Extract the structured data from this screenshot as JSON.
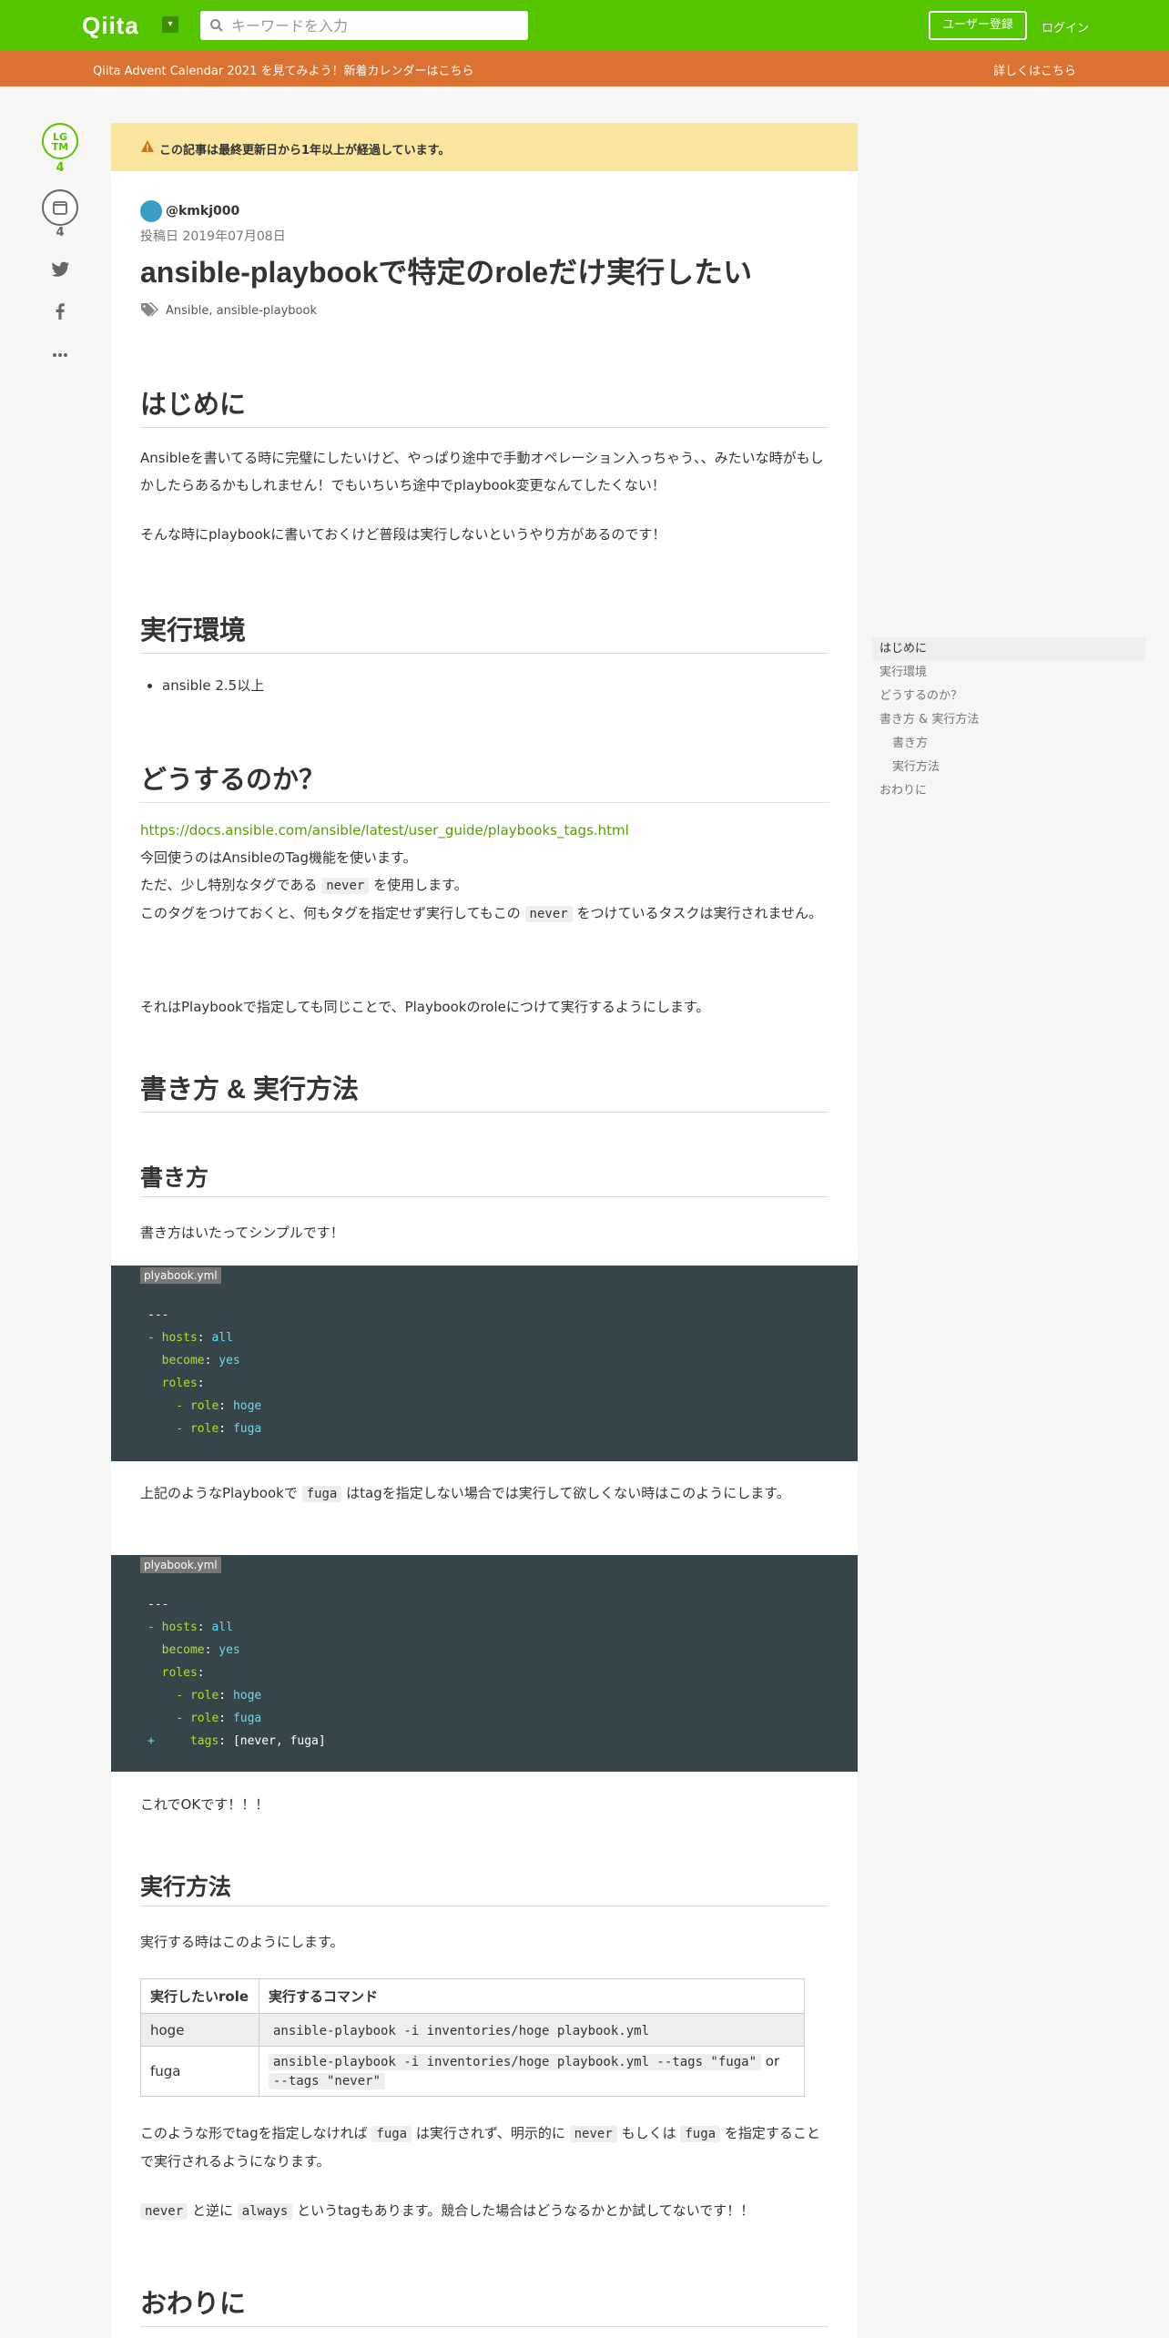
{
  "header": {
    "logo": "Qiita",
    "logo_menu": "▾",
    "search_placeholder": "キーワードを入力",
    "signup_label": "ユーザー登録",
    "login_label": "ログイン"
  },
  "banner": {
    "text": "Qiita Advent Calendar 2021 を見てみよう！新着カレンダーはこちら",
    "link": "詳しくはこちら"
  },
  "actions": {
    "lgtm_label": "LG TM",
    "lgtm_count": "4",
    "stock_count": "4"
  },
  "article": {
    "notice": "この記事は最終更新日から1年以上が経過しています。",
    "author": "@kmkj000",
    "posted": "投稿日 2019年07月08日",
    "title": "ansible-playbookで特定のroleだけ実行したい",
    "tags": "Ansible,  ansible-playbook",
    "sections": {
      "intro_heading": "はじめに",
      "intro_p1": "Ansibleを書いてる時に完璧にしたいけど、やっぱり途中で手動オペレーション入っちゃう、、みたいな時がもしかしたらあるかもしれません！でもいちいち途中でplaybook変更なんてしたくない！",
      "intro_p2": "そんな時にplaybookに書いておくけど普段は実行しないというやり方があるのです！",
      "env_heading": "実行環境",
      "env_item": "ansible 2.5以上",
      "how_heading": "どうするのか？",
      "how_link": "https://docs.ansible.com/ansible/latest/user_guide/playbooks_tags.html",
      "how_l1": "今回使うのはAnsibleのTag機能を使います。",
      "how_l2_a": "ただ、少し特別なタグである",
      "how_l2_code": "never",
      "how_l2_b": "を使用します。",
      "how_l3_a": "このタグをつけておくと、何もタグを指定せず実行してもこの",
      "how_l3_code": "never",
      "how_l3_b": "をつけているタスクは実行されません。",
      "how_p2": "それはPlaybookで指定しても同じことで、Playbookのroleにつけて実行するようにします。",
      "write_run_heading": "書き方 & 実行方法",
      "write_heading": "書き方",
      "write_p": "書き方はいたってシンプルです！",
      "code1_filename": "plyabook.yml",
      "after_code1_a": "上記のようなPlaybookで",
      "after_code1_code": "fuga",
      "after_code1_b": "はtagを指定しない場合では実行して欲しくない時はこのようにします。",
      "code2_filename": "plyabook.yml",
      "ok_text": "これでOKです！！！",
      "run_heading": "実行方法",
      "run_p": "実行する時はこのようにします。",
      "table": {
        "headers": [
          "実行したいrole",
          "実行するコマンド"
        ],
        "rows": [
          {
            "role": "hoge",
            "cmd": "ansible-playbook -i inventories/hoge playbook.yml"
          },
          {
            "role": "fuga",
            "cmd": "ansible-playbook -i inventories/hoge playbook.yml --tags \"fuga\"",
            "or": "or",
            "cmd2": "--tags \"never\""
          }
        ]
      },
      "after_table_a": "このような形でtagを指定しなければ",
      "after_table_code1": "fuga",
      "after_table_b": "は実行されず、明示的に",
      "after_table_code2": "never",
      "after_table_c": "もしくは",
      "after_table_code3": "fuga",
      "after_table_d": "を指定することで実行されるようになります。",
      "always_code1": "never",
      "always_a": "と逆に",
      "always_code2": "always",
      "always_b": "というtagもあります。競合した場合はどうなるかとか試してないです！！",
      "end_heading": "おわりに"
    },
    "code1": [
      {
        "plain": "---"
      },
      {
        "dash": "- ",
        "key": "hosts",
        "sep": ": ",
        "val": "all"
      },
      {
        "indent": "  ",
        "key": "become",
        "sep": ": ",
        "val": "yes"
      },
      {
        "indent": "  ",
        "key": "roles",
        "sep": ":",
        "val": ""
      },
      {
        "indent": "    ",
        "dash": "- ",
        "key": "role",
        "sep": ": ",
        "val": "hoge"
      },
      {
        "indent": "    ",
        "dash": "- ",
        "key": "role",
        "sep": ": ",
        "val": "fuga"
      }
    ],
    "code2": [
      {
        "plain": "---"
      },
      {
        "dash": "- ",
        "key": "hosts",
        "sep": ": ",
        "val": "all"
      },
      {
        "indent": "  ",
        "key": "become",
        "sep": ": ",
        "val": "yes"
      },
      {
        "indent": "  ",
        "key": "roles",
        "sep": ":",
        "val": ""
      },
      {
        "indent": "    ",
        "dash": "- ",
        "key": "role",
        "sep": ": ",
        "val": "hoge"
      },
      {
        "indent": "    ",
        "dash": "- ",
        "key": "role",
        "sep": ": ",
        "val": "fuga"
      },
      {
        "plus": "+",
        "indent": "     ",
        "key": "tags",
        "sep": ": ",
        "val": "[never, fuga]",
        "valplain": true
      }
    ]
  },
  "toc": [
    {
      "label": "はじめに",
      "active": true
    },
    {
      "label": "実行環境"
    },
    {
      "label": "どうするのか？"
    },
    {
      "label": "書き方 & 実行方法"
    },
    {
      "label": "書き方",
      "sub": true
    },
    {
      "label": "実行方法",
      "sub": true
    },
    {
      "label": "おわりに"
    }
  ],
  "colors": {
    "brand": "#55c500",
    "banner": "#db7232",
    "notice": "#fbe6a0",
    "code_bg": "#364549"
  }
}
